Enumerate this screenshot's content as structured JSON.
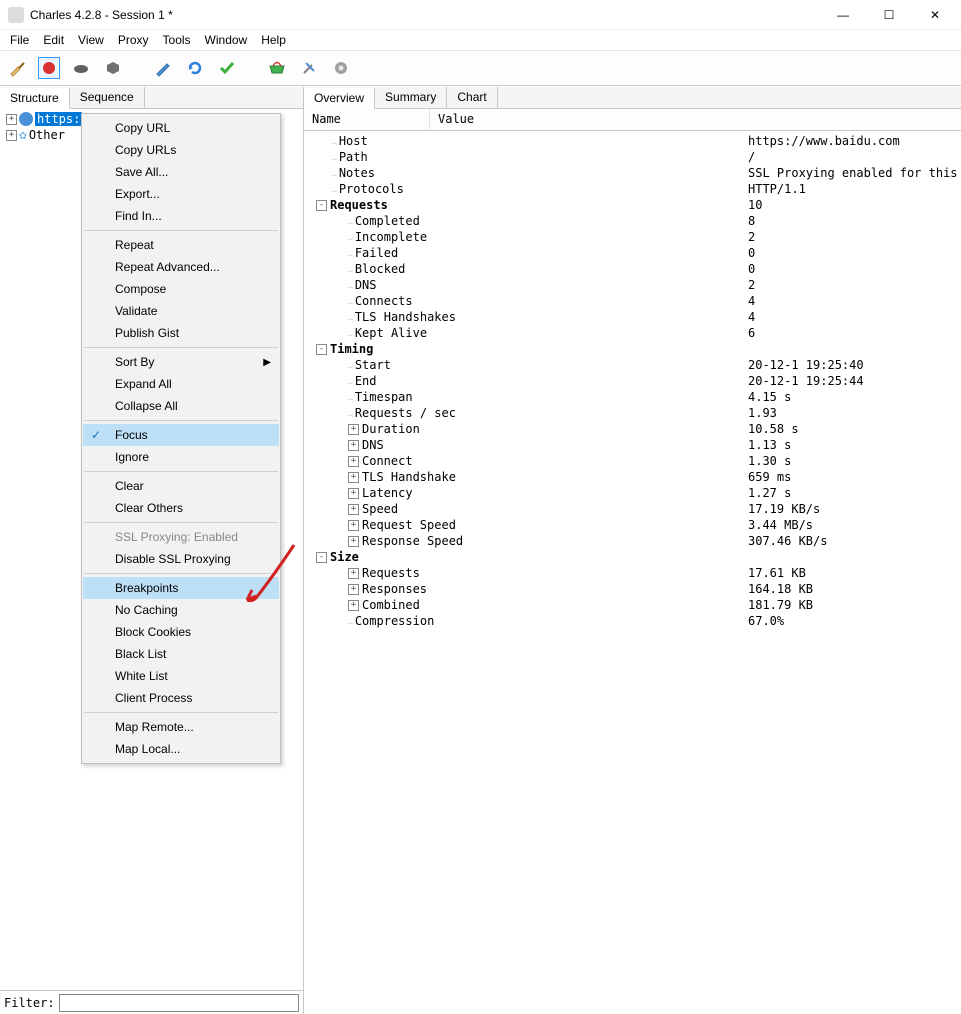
{
  "window": {
    "title": "Charles 4.2.8 - Session 1 *",
    "min": "—",
    "max": "☐",
    "close": "✕"
  },
  "menubar": [
    "File",
    "Edit",
    "View",
    "Proxy",
    "Tools",
    "Window",
    "Help"
  ],
  "left_tabs": [
    "Structure",
    "Sequence"
  ],
  "tree": {
    "item1": "https:",
    "item2": "Other "
  },
  "filter_label": "Filter:",
  "ctx": [
    {
      "t": "item",
      "label": "Copy URL"
    },
    {
      "t": "item",
      "label": "Copy URLs"
    },
    {
      "t": "item",
      "label": "Save All..."
    },
    {
      "t": "item",
      "label": "Export..."
    },
    {
      "t": "item",
      "label": "Find In..."
    },
    {
      "t": "sep"
    },
    {
      "t": "item",
      "label": "Repeat"
    },
    {
      "t": "item",
      "label": "Repeat Advanced..."
    },
    {
      "t": "item",
      "label": "Compose"
    },
    {
      "t": "item",
      "label": "Validate"
    },
    {
      "t": "item",
      "label": "Publish Gist"
    },
    {
      "t": "sep"
    },
    {
      "t": "item",
      "label": "Sort By",
      "sub": true
    },
    {
      "t": "item",
      "label": "Expand All"
    },
    {
      "t": "item",
      "label": "Collapse All"
    },
    {
      "t": "sep"
    },
    {
      "t": "item",
      "label": "Focus",
      "check": true,
      "hl": true
    },
    {
      "t": "item",
      "label": "Ignore"
    },
    {
      "t": "sep"
    },
    {
      "t": "item",
      "label": "Clear"
    },
    {
      "t": "item",
      "label": "Clear Others"
    },
    {
      "t": "sep"
    },
    {
      "t": "item",
      "label": "SSL Proxying: Enabled",
      "disabled": true
    },
    {
      "t": "item",
      "label": "Disable SSL Proxying"
    },
    {
      "t": "sep"
    },
    {
      "t": "item",
      "label": "Breakpoints",
      "hl": true
    },
    {
      "t": "item",
      "label": "No Caching"
    },
    {
      "t": "item",
      "label": "Block Cookies"
    },
    {
      "t": "item",
      "label": "Black List"
    },
    {
      "t": "item",
      "label": "White List"
    },
    {
      "t": "item",
      "label": "Client Process"
    },
    {
      "t": "sep"
    },
    {
      "t": "item",
      "label": "Map Remote..."
    },
    {
      "t": "item",
      "label": "Map Local..."
    }
  ],
  "right_tabs": [
    "Overview",
    "Summary",
    "Chart"
  ],
  "ov_cols": {
    "name": "Name",
    "value": "Value"
  },
  "overview": [
    {
      "ind": 1,
      "exp": "",
      "name": "Host",
      "val": "https://www.baidu.com"
    },
    {
      "ind": 1,
      "exp": "",
      "name": "Path",
      "val": "/"
    },
    {
      "ind": 1,
      "exp": "",
      "name": "Notes",
      "val": "SSL Proxying enabled for this host"
    },
    {
      "ind": 1,
      "exp": "",
      "name": "Protocols",
      "val": "HTTP/1.1"
    },
    {
      "ind": 0,
      "exp": "-",
      "name": "Requests",
      "val": "10",
      "bold": true
    },
    {
      "ind": 2,
      "exp": "",
      "name": "Completed",
      "val": "8"
    },
    {
      "ind": 2,
      "exp": "",
      "name": "Incomplete",
      "val": "2"
    },
    {
      "ind": 2,
      "exp": "",
      "name": "Failed",
      "val": "0"
    },
    {
      "ind": 2,
      "exp": "",
      "name": "Blocked",
      "val": "0"
    },
    {
      "ind": 2,
      "exp": "",
      "name": "DNS",
      "val": "2"
    },
    {
      "ind": 2,
      "exp": "",
      "name": "Connects",
      "val": "4"
    },
    {
      "ind": 2,
      "exp": "",
      "name": "TLS Handshakes",
      "val": "4"
    },
    {
      "ind": 2,
      "exp": "",
      "name": "Kept Alive",
      "val": "6"
    },
    {
      "ind": 0,
      "exp": "-",
      "name": "Timing",
      "val": "",
      "bold": true
    },
    {
      "ind": 2,
      "exp": "",
      "name": "Start",
      "val": "20-12-1 19:25:40"
    },
    {
      "ind": 2,
      "exp": "",
      "name": "End",
      "val": "20-12-1 19:25:44"
    },
    {
      "ind": 2,
      "exp": "",
      "name": "Timespan",
      "val": "4.15 s"
    },
    {
      "ind": 2,
      "exp": "",
      "name": "Requests / sec",
      "val": "1.93"
    },
    {
      "ind": 2,
      "exp": "+",
      "name": "Duration",
      "val": "10.58 s"
    },
    {
      "ind": 2,
      "exp": "+",
      "name": "DNS",
      "val": "1.13 s"
    },
    {
      "ind": 2,
      "exp": "+",
      "name": "Connect",
      "val": "1.30 s"
    },
    {
      "ind": 2,
      "exp": "+",
      "name": "TLS Handshake",
      "val": "659 ms"
    },
    {
      "ind": 2,
      "exp": "+",
      "name": "Latency",
      "val": "1.27 s"
    },
    {
      "ind": 2,
      "exp": "+",
      "name": "Speed",
      "val": "17.19 KB/s"
    },
    {
      "ind": 2,
      "exp": "+",
      "name": "Request Speed",
      "val": "3.44 MB/s"
    },
    {
      "ind": 2,
      "exp": "+",
      "name": "Response Speed",
      "val": "307.46 KB/s"
    },
    {
      "ind": 0,
      "exp": "-",
      "name": "Size",
      "val": "",
      "bold": true
    },
    {
      "ind": 2,
      "exp": "+",
      "name": "Requests",
      "val": "17.61 KB"
    },
    {
      "ind": 2,
      "exp": "+",
      "name": "Responses",
      "val": "164.18 KB"
    },
    {
      "ind": 2,
      "exp": "+",
      "name": "Combined",
      "val": "181.79 KB"
    },
    {
      "ind": 2,
      "exp": "",
      "name": "Compression",
      "val": "67.0%"
    }
  ]
}
